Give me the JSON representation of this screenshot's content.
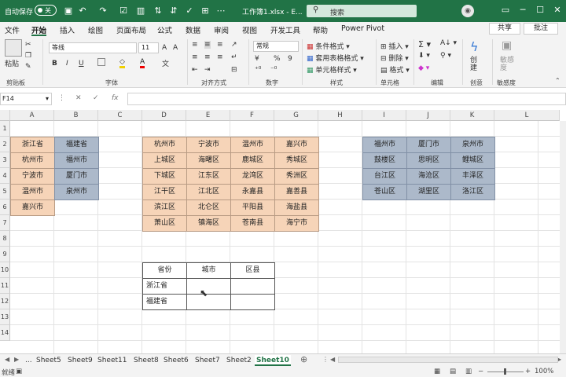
{
  "titlebar": {
    "autosave_label": "自动保存",
    "autosave_state": "关",
    "document": "工作簿1.xlsx - E...",
    "search": "搜索",
    "icons": [
      "save-icon",
      "undo-icon",
      "redo-icon",
      "checkbox-icon",
      "chart-icon",
      "sort-icon",
      "more-icon"
    ]
  },
  "tabs": [
    "文件",
    "开始",
    "插入",
    "绘图",
    "页面布局",
    "公式",
    "数据",
    "审阅",
    "视图",
    "开发工具",
    "帮助",
    "Power Pivot"
  ],
  "tabs_actions": {
    "share": "共享",
    "comment": "批注"
  },
  "ribbon": {
    "paste": "粘贴",
    "font_name": "等线",
    "font_size": "11",
    "bold": "B",
    "italic": "I",
    "underline": "U",
    "number_format": "常规",
    "percent": "%",
    "comma": "9",
    "currency": "¥",
    "conditional_format": "条件格式",
    "table_format": "套用表格格式",
    "cell_style": "单元格样式",
    "insert": "插入",
    "delete": "删除",
    "format": "格式",
    "create": "创建",
    "sensitivity": "敏感度",
    "groups": [
      "剪贴板",
      "字体",
      "对齐方式",
      "数字",
      "样式",
      "单元格",
      "编辑",
      "创意",
      "敏感度"
    ]
  },
  "formula_bar": {
    "namebox": "F14",
    "cancel": "✕",
    "confirm": "✓",
    "fx": "fx",
    "content": ""
  },
  "columns": [
    "A",
    "B",
    "C",
    "D",
    "E",
    "F",
    "G",
    "H",
    "I",
    "J",
    "K",
    "L"
  ],
  "rows": [
    "1",
    "2",
    "3",
    "4",
    "5",
    "6",
    "7",
    "8",
    "9",
    "10",
    "11",
    "12",
    "13",
    "14"
  ],
  "table1": {
    "col_a": [
      "浙江省",
      "杭州市",
      "宁波市",
      "温州市",
      "嘉兴市"
    ],
    "col_b": [
      "福建省",
      "福州市",
      "厦门市",
      "泉州市"
    ]
  },
  "table2": [
    [
      "杭州市",
      "宁波市",
      "温州市",
      "嘉兴市"
    ],
    [
      "上城区",
      "海曙区",
      "鹿城区",
      "秀城区"
    ],
    [
      "下城区",
      "江东区",
      "龙湾区",
      "秀洲区"
    ],
    [
      "江干区",
      "江北区",
      "永嘉县",
      "嘉善县"
    ],
    [
      "滨江区",
      "北仑区",
      "平阳县",
      "海盐县"
    ],
    [
      "萧山区",
      "镇海区",
      "苍南县",
      "海宁市"
    ]
  ],
  "table3": [
    [
      "福州市",
      "厦门市",
      "泉州市"
    ],
    [
      "鼓楼区",
      "思明区",
      "鲤城区"
    ],
    [
      "台江区",
      "海沧区",
      "丰泽区"
    ],
    [
      "苍山区",
      "湖里区",
      "洛江区"
    ]
  ],
  "table4": {
    "headers": [
      "省份",
      "城市",
      "区县"
    ],
    "rows": [
      [
        "浙江省",
        "",
        ""
      ],
      [
        "福建省",
        "",
        ""
      ]
    ]
  },
  "sheets": [
    "...",
    "Sheet5",
    "Sheet9",
    "Sheet11",
    "Sheet8",
    "Sheet6",
    "Sheet7",
    "Sheet2",
    "Sheet10"
  ],
  "active_sheet": "Sheet10",
  "status": {
    "ready": "就绪",
    "zoom": "100%"
  }
}
